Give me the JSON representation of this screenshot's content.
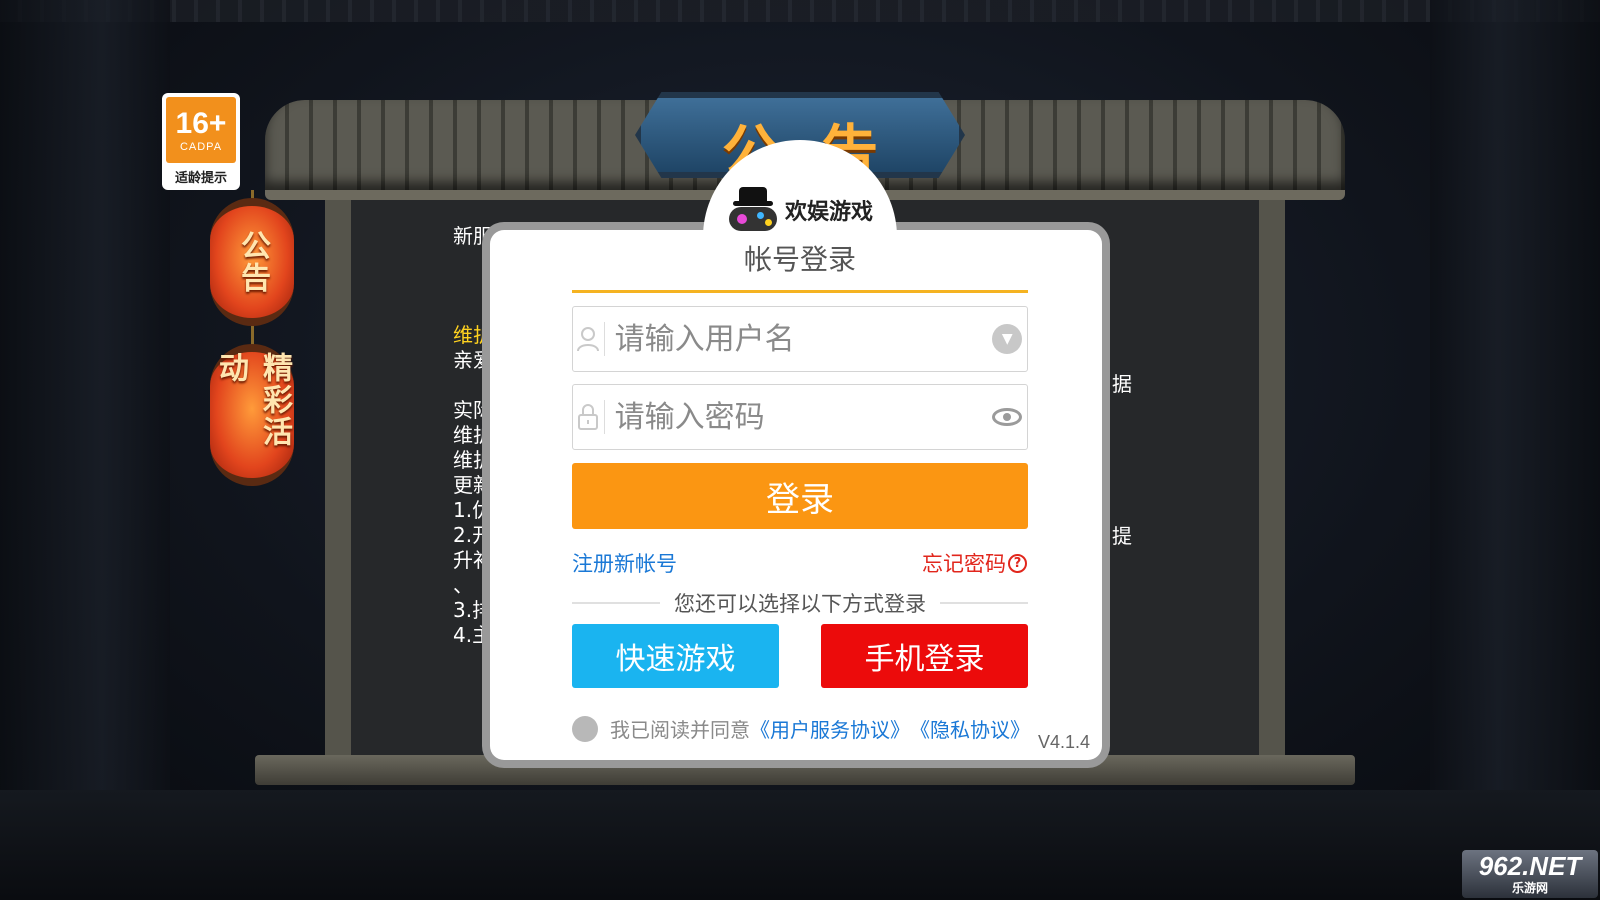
{
  "board": {
    "title": "公告",
    "notice_lines_left": [
      "新服",
      "维护",
      "亲爱",
      "实际",
      "维护",
      "维护",
      "更新",
      "1.优",
      "2.开",
      "升补",
      "、",
      "3.排",
      "4.主"
    ],
    "notice_fragment_right_1": "据",
    "notice_fragment_right_2": "提"
  },
  "age_rating": {
    "age": "16+",
    "org": "CADPA",
    "tip": "适龄提示"
  },
  "side_tabs": {
    "announcement": "公告",
    "events": "精彩活动"
  },
  "logo": {
    "brand": "欢娱游戏"
  },
  "login": {
    "title": "帐号登录",
    "username_placeholder": "请输入用户名",
    "password_placeholder": "请输入密码",
    "submit_label": "登录",
    "register_link": "注册新帐号",
    "forgot_link": "忘记密码",
    "alt_login_text": "您还可以选择以下方式登录",
    "quick_play_label": "快速游戏",
    "phone_login_label": "手机登录",
    "agree_text": "我已阅读并同意",
    "terms_link": "《用户服务协议》",
    "privacy_link": "《隐私协议》",
    "version": "V4.1.4"
  },
  "watermark": {
    "top": "962.NET",
    "bottom": "乐游网"
  },
  "colors": {
    "accent_orange": "#fb9612",
    "quick_blue": "#1ab4f0",
    "phone_red": "#ec0b0b",
    "link_blue": "#1a78d6",
    "forgot_red": "#e1261c"
  }
}
